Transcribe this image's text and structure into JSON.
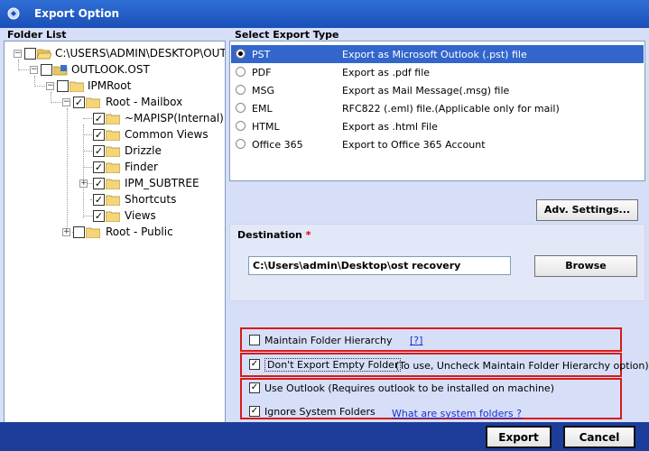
{
  "window": {
    "title": "Export Option"
  },
  "folder_list": {
    "header": "Folder List",
    "nodes": [
      {
        "label": "C:\\USERS\\ADMIN\\DESKTOP\\OUTLO",
        "checked": false
      },
      {
        "label": "OUTLOOK.OST",
        "checked": false
      },
      {
        "label": "IPMRoot",
        "checked": false
      },
      {
        "label": "Root - Mailbox",
        "checked": true
      },
      {
        "label": "~MAPISP(Internal)",
        "checked": true
      },
      {
        "label": "Common Views",
        "checked": true
      },
      {
        "label": "Drizzle",
        "checked": true
      },
      {
        "label": "Finder",
        "checked": true
      },
      {
        "label": "IPM_SUBTREE",
        "checked": true
      },
      {
        "label": "Shortcuts",
        "checked": true
      },
      {
        "label": "Views",
        "checked": true
      },
      {
        "label": "Root - Public",
        "checked": false
      }
    ]
  },
  "export_type": {
    "header": "Select Export Type",
    "options": [
      {
        "name": "PST",
        "desc": "Export as Microsoft Outlook (.pst) file",
        "selected": true
      },
      {
        "name": "PDF",
        "desc": "Export as .pdf file",
        "selected": false
      },
      {
        "name": "MSG",
        "desc": "Export as Mail Message(.msg) file",
        "selected": false
      },
      {
        "name": "EML",
        "desc": "RFC822 (.eml) file.(Applicable only for mail)",
        "selected": false
      },
      {
        "name": "HTML",
        "desc": "Export as .html File",
        "selected": false
      },
      {
        "name": "Office 365",
        "desc": "Export to Office 365 Account",
        "selected": false
      }
    ]
  },
  "adv_settings_label": "Adv. Settings...",
  "destination": {
    "label": "Destination",
    "required_mark": "*",
    "path": "C:\\Users\\admin\\Desktop\\ost recovery",
    "browse_label": "Browse"
  },
  "options": {
    "maintain_hierarchy": {
      "label": "Maintain Folder Hierarchy",
      "checked": false,
      "help": "[?]"
    },
    "dont_export_empty": {
      "label": "Don't Export Empty Folder",
      "checked": true,
      "note": "(To use, Uncheck Maintain Folder Hierarchy option)"
    },
    "use_outlook": {
      "label": "Use Outlook (Requires outlook to be installed on machine)",
      "checked": true
    },
    "ignore_system": {
      "label": "Ignore System Folders",
      "checked": true,
      "link": "What are system folders ?"
    }
  },
  "buttons": {
    "export": "Export",
    "cancel": "Cancel"
  },
  "colors": {
    "title_bar": "#1a4fb8",
    "selection": "#3266cc",
    "highlight_border": "#d91a1a",
    "link": "#1a2fd0",
    "background": "#d6dff7"
  }
}
